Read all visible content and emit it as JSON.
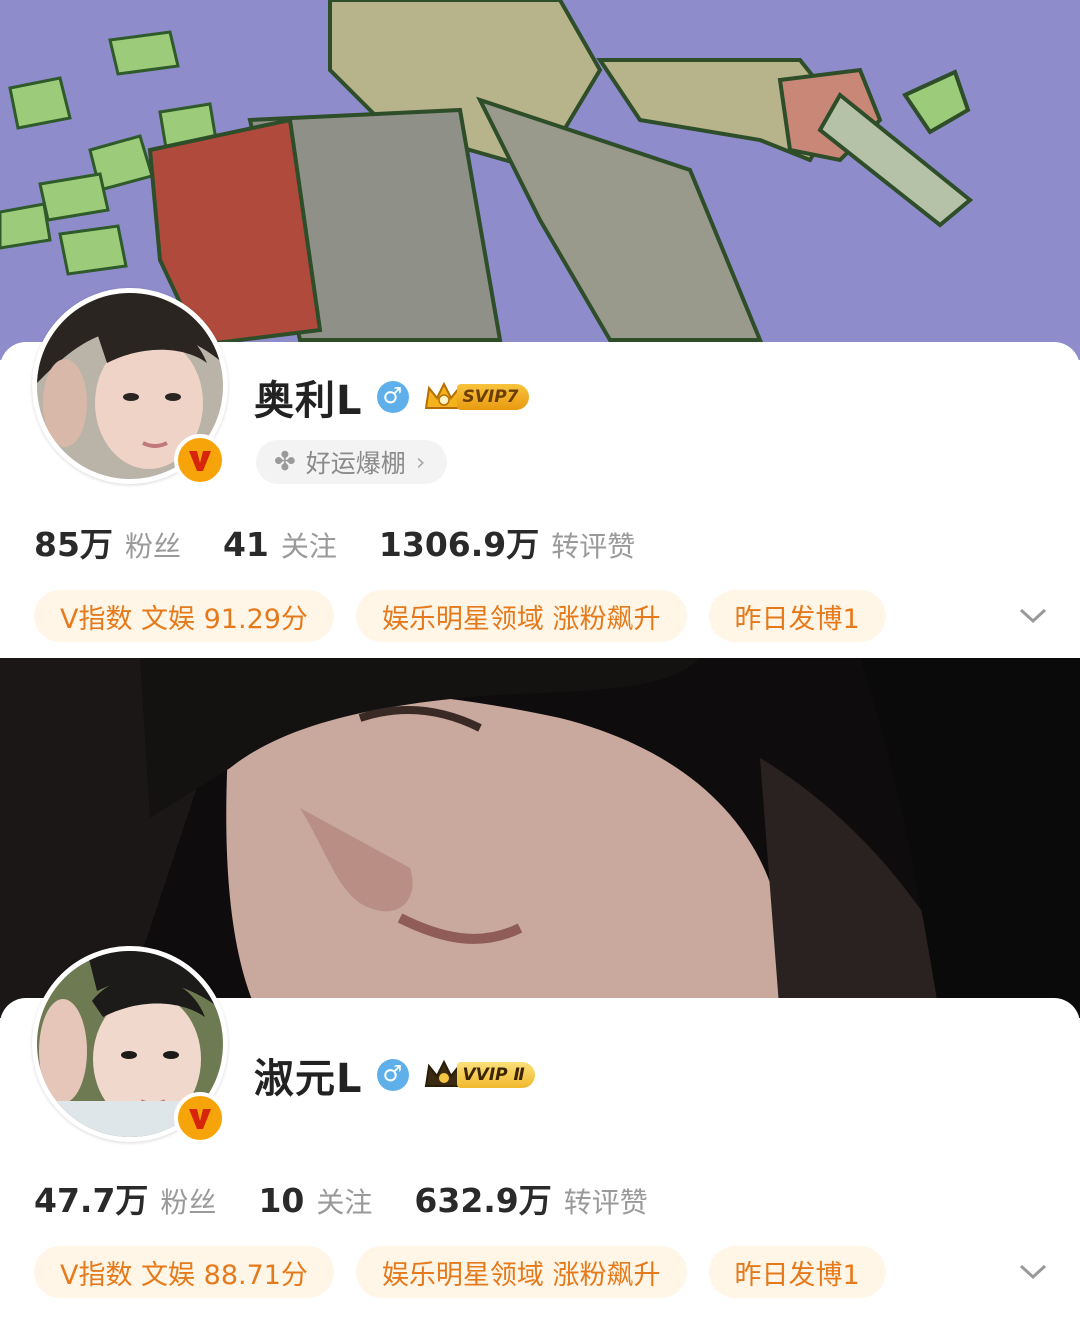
{
  "profiles": [
    {
      "name": "奥利L",
      "gender_symbol": "♂",
      "vip_label": "SVIP7",
      "fortune_tag": "好运爆棚",
      "stats": [
        {
          "value": "85万",
          "label": "粉丝"
        },
        {
          "value": "41",
          "label": "关注"
        },
        {
          "value": "1306.9万",
          "label": "转评赞"
        }
      ],
      "tags": [
        "V指数 文娱 91.29分",
        "娱乐明星领域 涨粉飙升",
        "昨日发博1"
      ]
    },
    {
      "name": "淑元L",
      "gender_symbol": "♂",
      "vip_label": "VVIP Ⅱ",
      "stats": [
        {
          "value": "47.7万",
          "label": "粉丝"
        },
        {
          "value": "10",
          "label": "关注"
        },
        {
          "value": "632.9万",
          "label": "转评赞"
        }
      ],
      "tags": [
        "V指数 文娱 88.71分",
        "娱乐明星领域 涨粉飙升",
        "昨日发博1"
      ]
    }
  ],
  "icons": {
    "verified": "v-badge-icon",
    "gender": "male-icon",
    "fortune": "clover-icon",
    "expand": "chevron-down-icon"
  },
  "colors": {
    "tag_text": "#e57a1c",
    "tag_bg": "#fff6e8",
    "verified_badge": "#f6a40a",
    "gender_badge": "#5fb0ea"
  }
}
